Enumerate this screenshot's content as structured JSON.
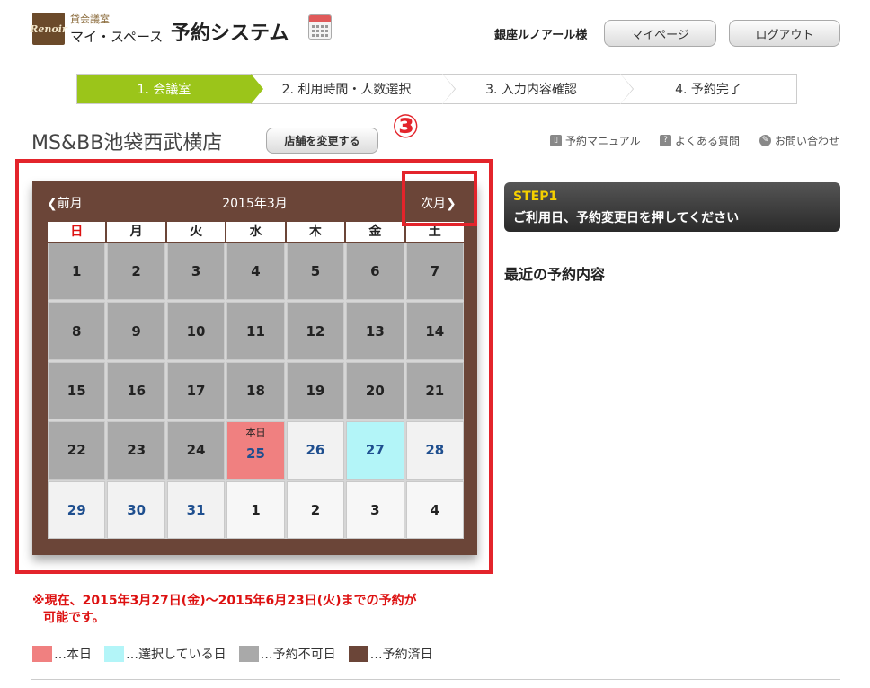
{
  "header": {
    "logo_text": "Renoir",
    "brand_small": "貸会議室",
    "brand_big": "マイ・スペース",
    "app_title": "予約システム",
    "user_name": "銀座ルノアール様",
    "mypage_label": "マイページ",
    "logout_label": "ログアウト"
  },
  "steps": [
    {
      "label": "1. 会議室",
      "active": true
    },
    {
      "label": "2. 利用時間・人数選択",
      "active": false
    },
    {
      "label": "3. 入力内容確認",
      "active": false
    },
    {
      "label": "4. 予約完了",
      "active": false
    }
  ],
  "store": {
    "name": "MS&BB池袋西武横店",
    "change_label": "店舗を変更する"
  },
  "annotation": "③",
  "links": {
    "manual": "予約マニュアル",
    "faq": "よくある質問",
    "contact": "お問い合わせ"
  },
  "calendar": {
    "prev_label": "❮前月",
    "month_label": "2015年3月",
    "next_label": "次月❯",
    "weekdays": [
      "日",
      "月",
      "火",
      "水",
      "木",
      "金",
      "土"
    ],
    "today_label": "本日",
    "days": [
      {
        "d": "1",
        "s": "unavail"
      },
      {
        "d": "2",
        "s": "unavail"
      },
      {
        "d": "3",
        "s": "unavail"
      },
      {
        "d": "4",
        "s": "unavail"
      },
      {
        "d": "5",
        "s": "unavail"
      },
      {
        "d": "6",
        "s": "unavail"
      },
      {
        "d": "7",
        "s": "unavail"
      },
      {
        "d": "8",
        "s": "unavail"
      },
      {
        "d": "9",
        "s": "unavail"
      },
      {
        "d": "10",
        "s": "unavail"
      },
      {
        "d": "11",
        "s": "unavail"
      },
      {
        "d": "12",
        "s": "unavail"
      },
      {
        "d": "13",
        "s": "unavail"
      },
      {
        "d": "14",
        "s": "unavail"
      },
      {
        "d": "15",
        "s": "unavail"
      },
      {
        "d": "16",
        "s": "unavail"
      },
      {
        "d": "17",
        "s": "unavail"
      },
      {
        "d": "18",
        "s": "unavail"
      },
      {
        "d": "19",
        "s": "unavail"
      },
      {
        "d": "20",
        "s": "unavail"
      },
      {
        "d": "21",
        "s": "unavail"
      },
      {
        "d": "22",
        "s": "unavail"
      },
      {
        "d": "23",
        "s": "unavail"
      },
      {
        "d": "24",
        "s": "unavail"
      },
      {
        "d": "25",
        "s": "today"
      },
      {
        "d": "26",
        "s": "future"
      },
      {
        "d": "27",
        "s": "selected"
      },
      {
        "d": "28",
        "s": "future"
      },
      {
        "d": "29",
        "s": "future"
      },
      {
        "d": "30",
        "s": "future"
      },
      {
        "d": "31",
        "s": "future"
      },
      {
        "d": "1",
        "s": "nextm"
      },
      {
        "d": "2",
        "s": "nextm"
      },
      {
        "d": "3",
        "s": "nextm"
      },
      {
        "d": "4",
        "s": "nextm"
      }
    ]
  },
  "right_panel": {
    "step_label": "STEP1",
    "step_text": "ご利用日、予約変更日を押してください",
    "recent_title": "最近の予約内容"
  },
  "note": {
    "line1": "※現在、2015年3月27日(金)～2015年6月23日(火)までの予約が",
    "line2": "可能です。"
  },
  "legend": [
    {
      "label": "…本日",
      "color": "#f08080"
    },
    {
      "label": "…選択している日",
      "color": "#b3f5f8"
    },
    {
      "label": "…予約不可日",
      "color": "#a9a9a9"
    },
    {
      "label": "…予約済日",
      "color": "#6b4538"
    }
  ]
}
